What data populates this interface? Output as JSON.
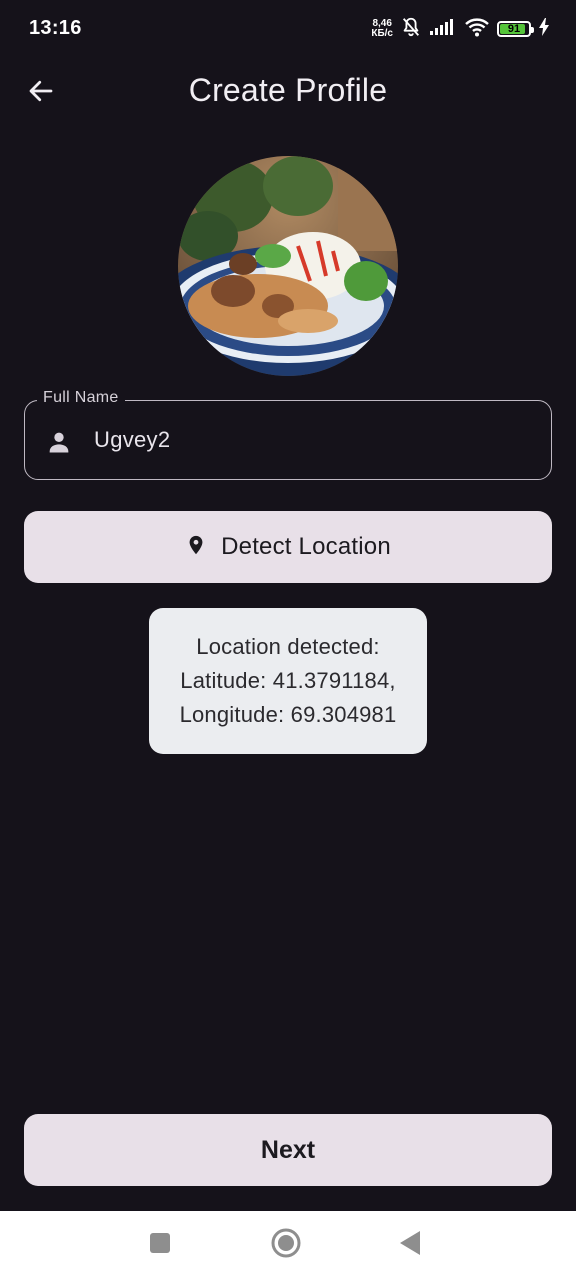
{
  "status_bar": {
    "time": "13:16",
    "speed_value": "8,46",
    "speed_unit": "КБ/с",
    "battery": "91",
    "battery_level": 0.91,
    "battery_color": "#55c43a",
    "icons": [
      "mute-bell-icon",
      "signal-icon",
      "wifi-icon",
      "battery-icon",
      "charging-icon"
    ]
  },
  "app_bar": {
    "back_icon": "arrow-left-icon",
    "title": "Create Profile"
  },
  "avatar": {
    "icon": "profile-photo"
  },
  "full_name_field": {
    "label": "Full Name",
    "value": "Ugvey2",
    "icon": "person-icon"
  },
  "detect_location_button": {
    "label": "Detect Location",
    "icon": "location-pin-icon"
  },
  "location_card": {
    "line1": "Location detected:",
    "line2": "Latitude: 41.3791184,",
    "line3": "Longitude: 69.304981"
  },
  "next_button": {
    "label": "Next"
  },
  "nav_bar": {
    "icons": [
      "recents-square-icon",
      "home-circle-icon",
      "back-triangle-icon"
    ]
  },
  "colors": {
    "background": "#15121a",
    "button_bg": "#e8e0e8",
    "card_bg": "#ebedf0",
    "field_border": "#bfb9c3"
  }
}
